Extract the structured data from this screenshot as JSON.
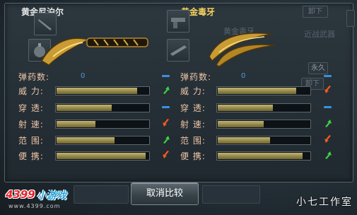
{
  "left_weapon": {
    "name": "黄金尼泊尔",
    "name_color": "#e6e6e6"
  },
  "right_weapon": {
    "name": "黄金毒牙",
    "name_color": "#f4d35e"
  },
  "background": {
    "unload_label": "卸下",
    "unload_label_2": "卸下",
    "melee_label": "近战武器",
    "permanent_label": "永久",
    "faded_title": "黄金毒牙"
  },
  "stats": [
    {
      "label": "弹药数:",
      "type": "ammo",
      "left_value": "0",
      "right_value": "0",
      "left_ind": "dash",
      "right_ind": "dash"
    },
    {
      "label": "威 力:",
      "type": "bar",
      "left_fill": 0.88,
      "right_fill": 0.85,
      "left_ind": "up",
      "right_ind": "down"
    },
    {
      "label": "穿 透:",
      "type": "bar",
      "left_fill": 0.6,
      "right_fill": 0.6,
      "left_ind": "dash",
      "right_ind": "dash"
    },
    {
      "label": "射 速:",
      "type": "bar",
      "left_fill": 0.42,
      "right_fill": 0.5,
      "left_ind": "down",
      "right_ind": "up"
    },
    {
      "label": "范 围:",
      "type": "bar",
      "left_fill": 0.63,
      "right_fill": 0.57,
      "left_ind": "up",
      "right_ind": "down"
    },
    {
      "label": "便 携:",
      "type": "bar",
      "left_fill": 0.97,
      "right_fill": 0.92,
      "left_ind": "down",
      "right_ind": "up"
    }
  ],
  "cancel_button": {
    "label": "取消比较"
  },
  "colors": {
    "up": "#3ed24a",
    "down": "#ff5a1e",
    "dash": "#3c8fe0",
    "bar_fill": "#b0a262",
    "label": "#f0c6a8"
  },
  "branding": {
    "logo_number": "4399",
    "logo_text": "小游戏",
    "logo_url": "www.4399.com",
    "watermark": "小七工作室"
  }
}
